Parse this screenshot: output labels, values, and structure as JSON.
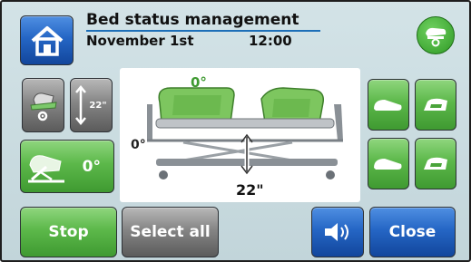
{
  "header": {
    "title": "Bed status management",
    "date": "November 1st",
    "time": "12:00"
  },
  "left_controls": {
    "height_value": "22\"",
    "tilt_value": "0°"
  },
  "bed_panel": {
    "backrest_angle": "0°",
    "trend_angle": "0°",
    "height": "22\""
  },
  "footer": {
    "stop_label": "Stop",
    "select_all_label": "Select all",
    "close_label": "Close"
  },
  "icons": {
    "home": "home-icon",
    "bed_status": "bed-status-icon",
    "sound": "speaker-icon"
  },
  "colors": {
    "green_button": "#5cb84a",
    "gray_button": "#858585",
    "blue_button": "#2566c5",
    "title_underline": "#1d6fb8",
    "angle_accent": "#3f9a31"
  }
}
